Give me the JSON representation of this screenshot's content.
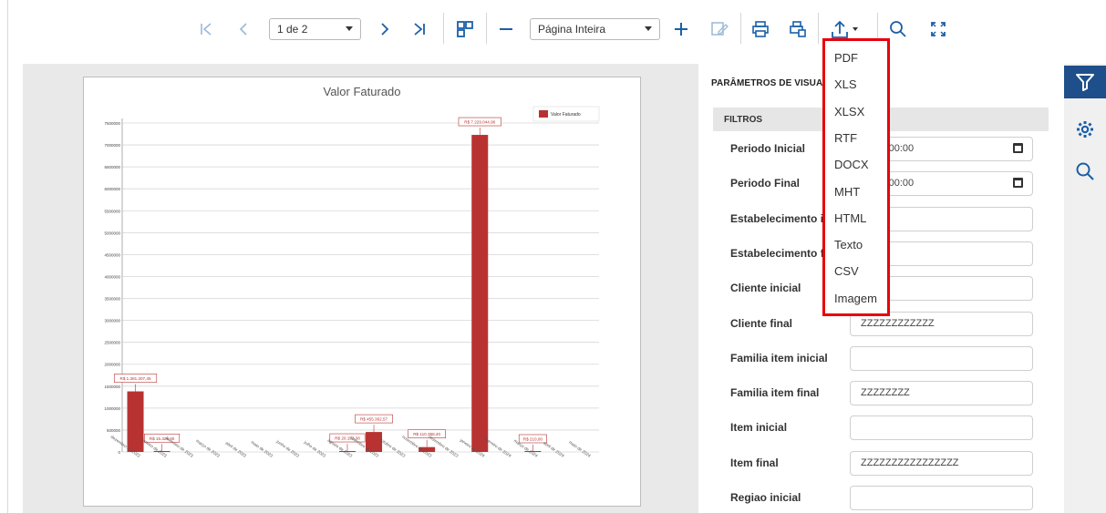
{
  "toolbar": {
    "page_select": "1 de 2",
    "zoom_select": "Página Inteira"
  },
  "export_menu": {
    "items": [
      "PDF",
      "XLS",
      "XLSX",
      "RTF",
      "DOCX",
      "MHT",
      "HTML",
      "Texto",
      "CSV",
      "Imagem"
    ]
  },
  "params": {
    "title": "PARÂMETROS DE VISUAL",
    "filters_label": "FILTROS",
    "fields": [
      {
        "label": "Periodo Inicial",
        "value": "2023, 00:00",
        "calendar": true
      },
      {
        "label": "Periodo Final",
        "value": "2024, 00:00",
        "calendar": true
      },
      {
        "label": "Estabelecimento ini",
        "value": ""
      },
      {
        "label": "Estabelecimento fir",
        "value": ""
      },
      {
        "label": "Cliente inicial",
        "value": ""
      },
      {
        "label": "Cliente final",
        "value": "ZZZZZZZZZZZZ"
      },
      {
        "label": "Familia item inicial",
        "value": ""
      },
      {
        "label": "Familia item final",
        "value": "ZZZZZZZZ"
      },
      {
        "label": "Item inicial",
        "value": ""
      },
      {
        "label": "Item final",
        "value": "ZZZZZZZZZZZZZZZZ"
      },
      {
        "label": "Regiao inicial",
        "value": ""
      }
    ]
  },
  "rail": {
    "icons": [
      "filter-icon",
      "gear-icon",
      "search-icon"
    ]
  },
  "colors": {
    "accent": "#1a5fa8",
    "bar": "#b83232",
    "highlight": "#e8000b",
    "rail_active": "#1f4f8a"
  },
  "chart_data": {
    "type": "bar",
    "title": "Valor Faturado",
    "legend": "Valor Faturado",
    "legend_position": "top-right",
    "grid": true,
    "ylim": [
      0,
      7500000
    ],
    "yticks": [
      "7500000",
      "7000000",
      "6500000",
      "6000000",
      "5500000",
      "5000000",
      "4500000",
      "4000000",
      "3500000",
      "3000000",
      "2500000",
      "2000000",
      "1500000",
      "1000000",
      "500000",
      "0"
    ],
    "categories": [
      "dezembro de 2022",
      "janeiro de 2023",
      "fevereiro de 2023",
      "março de 2023",
      "abril de 2023",
      "maio de 2023",
      "junho de 2023",
      "julho de 2023",
      "agosto de 2023",
      "setembro de 2023",
      "outubro de 2023",
      "novembro de 2023",
      "dezembro de 2023",
      "janeiro de 2024",
      "fevereiro de 2024",
      "março de 2024",
      "abril de 2024",
      "maio de 2024"
    ],
    "values": [
      1381000,
      15300,
      0,
      0,
      0,
      0,
      0,
      0,
      20100,
      455000,
      0,
      110400,
      0,
      7229000,
      0,
      210,
      0,
      0
    ],
    "data_labels": [
      "R$ 1.381.207,45",
      "R$ 15.328,80",
      "",
      "",
      "",
      "",
      "",
      "",
      "R$ 20.153,38",
      "R$ 455.362,57",
      "",
      "R$ 110.398,40",
      "",
      "R$ 7.229.044,96",
      "",
      "R$ 210,00",
      "",
      ""
    ]
  }
}
